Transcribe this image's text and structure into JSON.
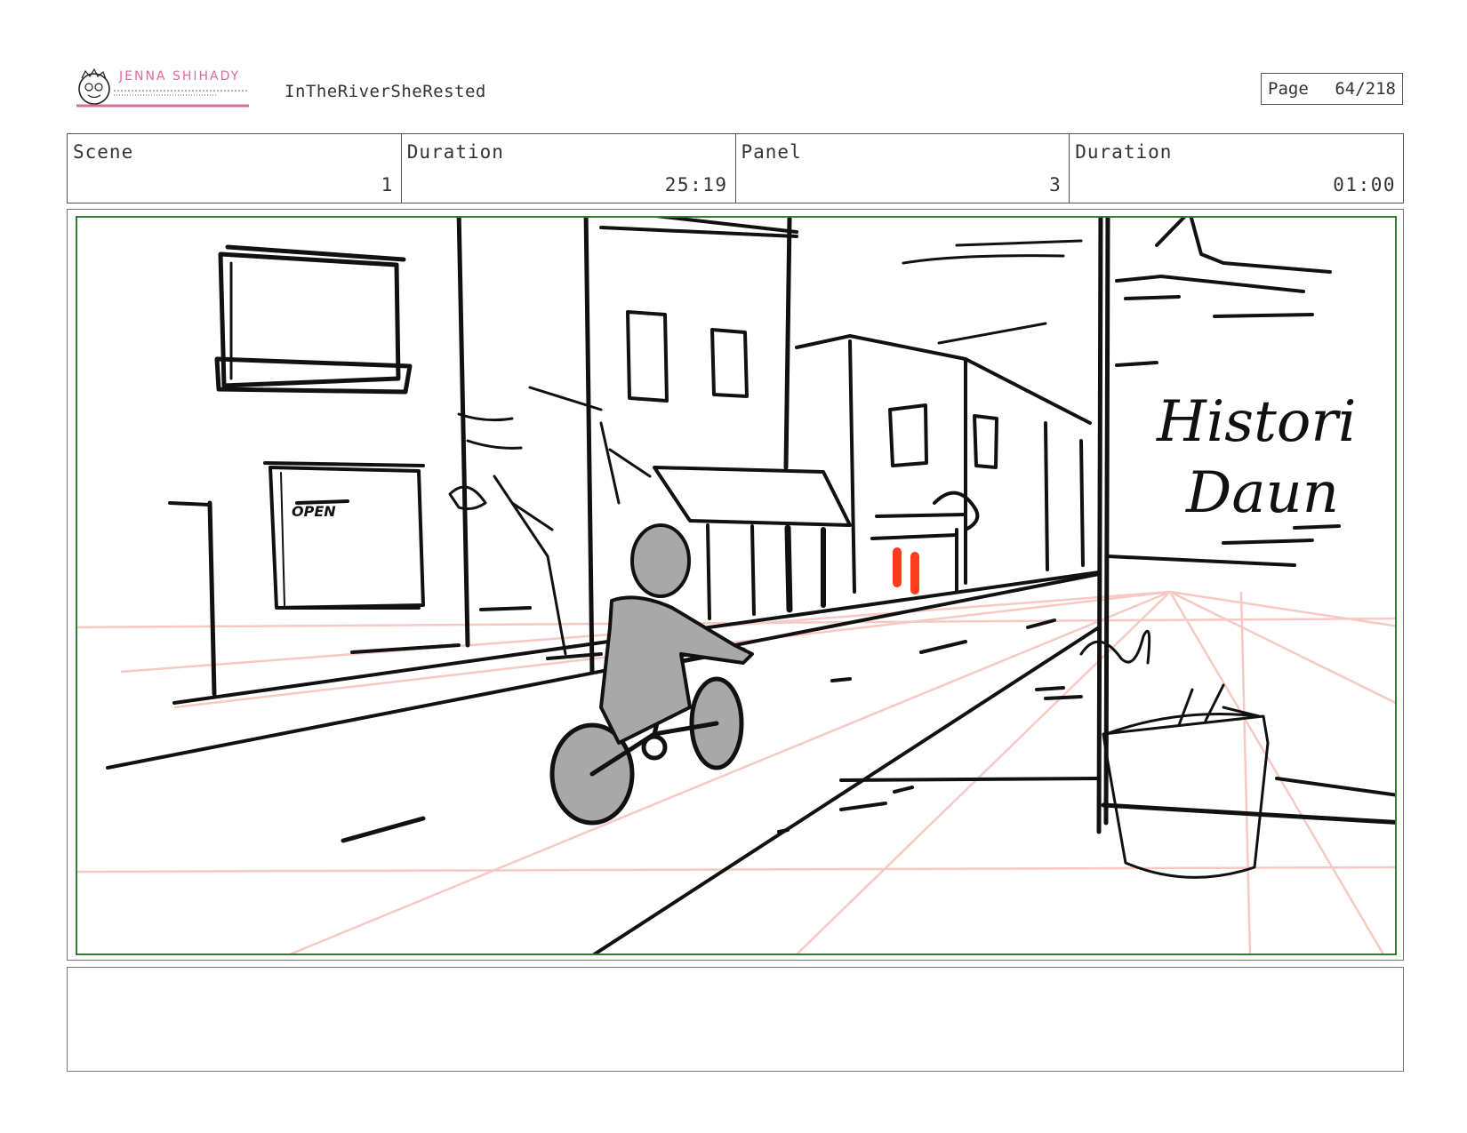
{
  "header": {
    "logo": {
      "text": "JENNA SHIHADY"
    },
    "project_title": "InTheRiverSheRested",
    "page": {
      "label": "Page",
      "value": "64/218"
    }
  },
  "info": {
    "scene": {
      "label": "Scene",
      "value": "1"
    },
    "scene_duration": {
      "label": "Duration",
      "value": "25:19"
    },
    "panel": {
      "label": "Panel",
      "value": "3"
    },
    "panel_duration": {
      "label": "Duration",
      "value": "01:00"
    }
  },
  "panel_art": {
    "sign_text_line1": "Histori",
    "sign_text_line2": "Daun",
    "shop_sign": "OPEN",
    "colors": {
      "frame_border": "#2e7d32",
      "figure_fill": "#a8a8a8",
      "accent_red": "#ff3b1f",
      "guide_lines": "#f6c9c4",
      "logo_pink": "#e06a9a"
    }
  },
  "notes": {
    "text": ""
  }
}
